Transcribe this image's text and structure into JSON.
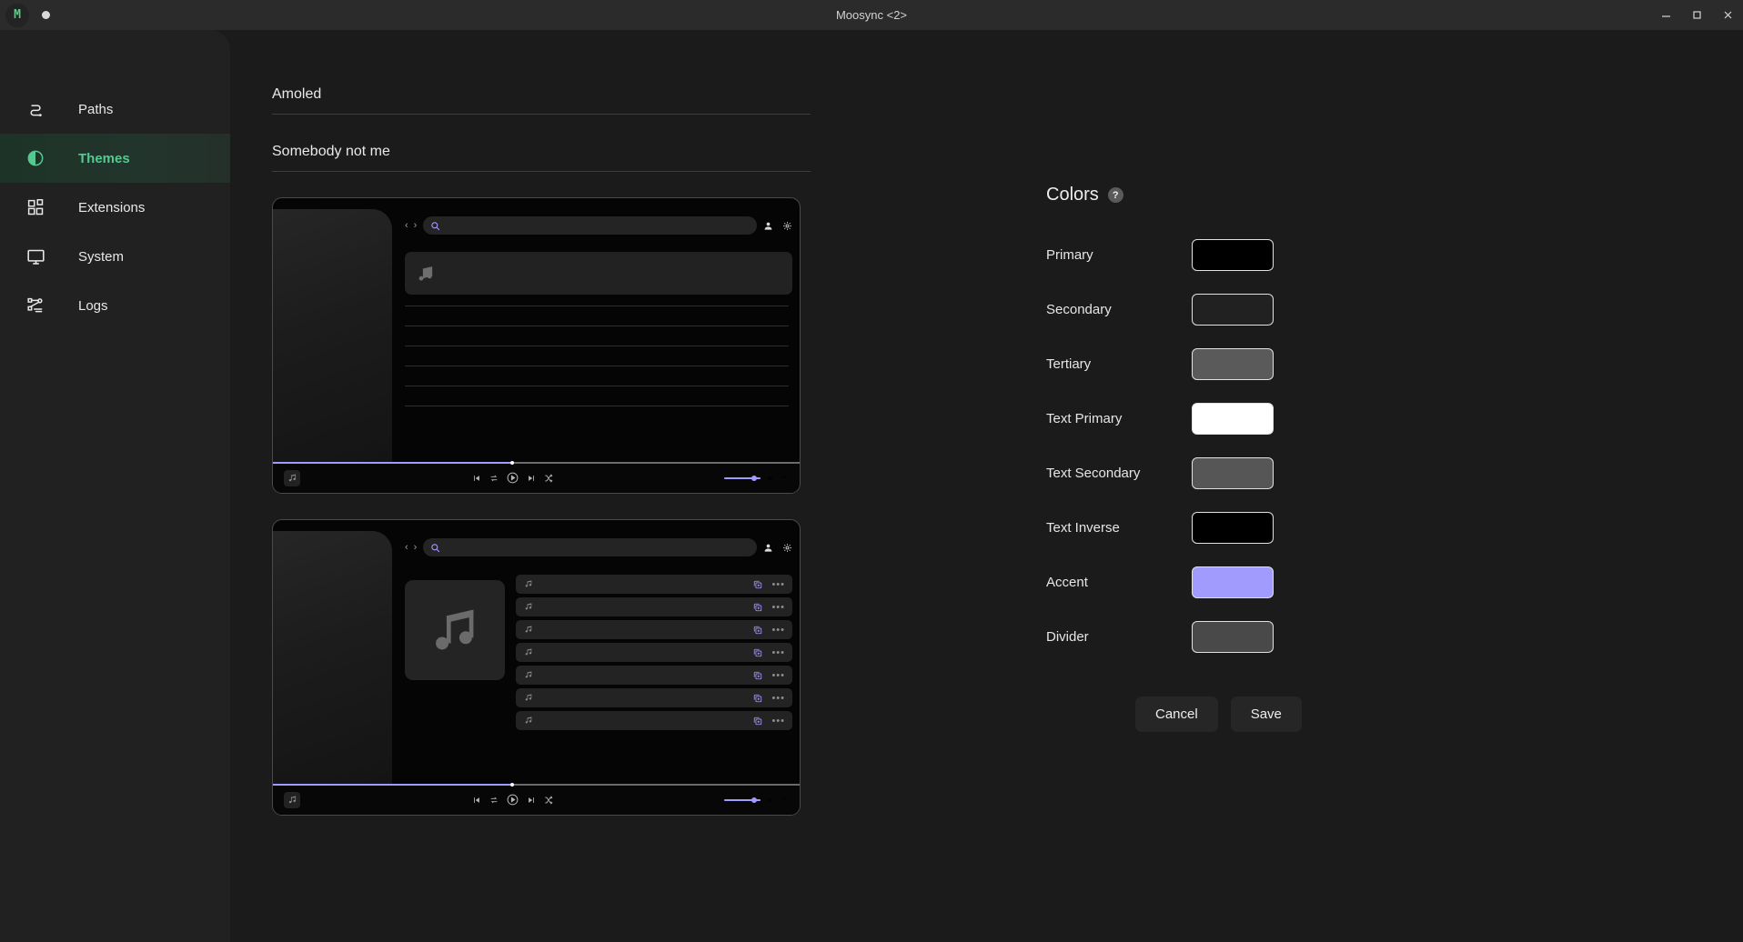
{
  "window": {
    "title": "Moosync <2>",
    "logo_text": "M",
    "logo_color": "#62c98c",
    "controls": {
      "minimize": "—",
      "maximize": "▢",
      "close": "✕"
    }
  },
  "sidebar": {
    "items": [
      {
        "label": "Paths",
        "icon": "path-route-icon",
        "active": false
      },
      {
        "label": "Themes",
        "icon": "theme-contrast-icon",
        "active": true
      },
      {
        "label": "Extensions",
        "icon": "extensions-blocks-icon",
        "active": false
      },
      {
        "label": "System",
        "icon": "monitor-icon",
        "active": false
      },
      {
        "label": "Logs",
        "icon": "logs-flow-icon",
        "active": false
      }
    ],
    "active_color": "#55c98f"
  },
  "form": {
    "theme_name": "Amoled",
    "theme_author": "Somebody not me"
  },
  "previews": [
    {
      "name": "compact-list-preview",
      "search_placeholder": "",
      "progress_percent": 45,
      "volume_percent": 85,
      "row_count": 6
    },
    {
      "name": "album-grid-preview",
      "search_placeholder": "",
      "progress_percent": 45,
      "volume_percent": 85,
      "song_count": 7
    }
  ],
  "colors_panel": {
    "title": "Colors",
    "help_glyph": "?",
    "swatches": [
      {
        "label": "Primary",
        "value": "#000000"
      },
      {
        "label": "Secondary",
        "value": "#212121"
      },
      {
        "label": "Tertiary",
        "value": "#5a5a5a"
      },
      {
        "label": "Text Primary",
        "value": "#ffffff"
      },
      {
        "label": "Text Secondary",
        "value": "#565656"
      },
      {
        "label": "Text Inverse",
        "value": "#000000"
      },
      {
        "label": "Accent",
        "value": "#a29bfe"
      },
      {
        "label": "Divider",
        "value": "#494949"
      }
    ],
    "buttons": {
      "cancel": "Cancel",
      "save": "Save"
    }
  }
}
